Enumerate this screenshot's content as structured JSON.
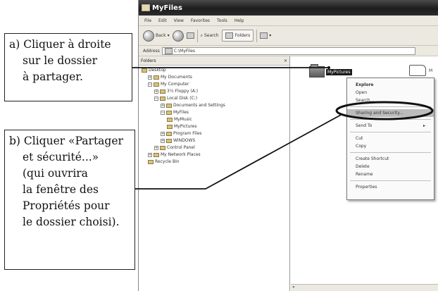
{
  "window": {
    "title": "MyFiles",
    "menu": [
      "File",
      "Edit",
      "View",
      "Favorites",
      "Tools",
      "Help"
    ],
    "toolbar": {
      "back_label": "Back",
      "search_label": "Search",
      "folders_label": "Folders"
    },
    "address": {
      "label": "Address",
      "value": "C:\\MyFiles"
    },
    "folders_pane": {
      "title": "Folders",
      "close_glyph": "×",
      "tree": [
        {
          "label": "Desktop",
          "level": 0,
          "expander": ""
        },
        {
          "label": "My Documents",
          "level": 1,
          "expander": "+"
        },
        {
          "label": "My Computer",
          "level": 1,
          "expander": "−"
        },
        {
          "label": "3½ Floppy (A:)",
          "level": 2,
          "expander": "+"
        },
        {
          "label": "Local Disk (C:)",
          "level": 2,
          "expander": "−"
        },
        {
          "label": "Documents and Settings",
          "level": 3,
          "expander": "+"
        },
        {
          "label": "MyFiles",
          "level": 3,
          "expander": "−"
        },
        {
          "label": "MyMusic",
          "level": 4,
          "expander": ""
        },
        {
          "label": "MyPictures",
          "level": 4,
          "expander": ""
        },
        {
          "label": "Program Files",
          "level": 3,
          "expander": "+"
        },
        {
          "label": "WINDOWS",
          "level": 3,
          "expander": "+"
        },
        {
          "label": "Control Panel",
          "level": 2,
          "expander": "+"
        },
        {
          "label": "My Network Places",
          "level": 1,
          "expander": "+"
        },
        {
          "label": "Recycle Bin",
          "level": 1,
          "expander": ""
        }
      ]
    },
    "right_pane": {
      "selected_folder": "MyPictures",
      "other_folder_label": "M"
    },
    "scroll_glyph": "«"
  },
  "context_menu": {
    "items": [
      {
        "label": "Explore",
        "bold": true,
        "arrow": "",
        "sep_after": false
      },
      {
        "label": "Open",
        "bold": false,
        "arrow": "",
        "sep_after": false
      },
      {
        "label": "Search...",
        "bold": false,
        "arrow": "",
        "sep_after": true
      },
      {
        "label": "Sharing and Security...",
        "bold": false,
        "arrow": "",
        "sep_after": true,
        "highlight": true
      },
      {
        "label": "Send To",
        "bold": false,
        "arrow": "▸",
        "sep_after": true
      },
      {
        "label": "Cut",
        "bold": false,
        "arrow": "",
        "sep_after": false
      },
      {
        "label": "Copy",
        "bold": false,
        "arrow": "",
        "sep_after": true
      },
      {
        "label": "Create Shortcut",
        "bold": false,
        "arrow": "",
        "sep_after": false
      },
      {
        "label": "Delete",
        "bold": false,
        "arrow": "",
        "sep_after": false
      },
      {
        "label": "Rename",
        "bold": false,
        "arrow": "",
        "sep_after": true
      },
      {
        "label": "Properties",
        "bold": false,
        "arrow": "",
        "sep_after": false
      }
    ]
  },
  "callouts": {
    "a": [
      "a) Cliquer à droite",
      "sur le dossier",
      "à partager."
    ],
    "b": [
      "b) Cliquer «Partager",
      "et sécurité...»",
      "(qui ouvrira",
      "la fenêtre des",
      "Propriétés pour",
      "le dossier choisi)."
    ]
  }
}
